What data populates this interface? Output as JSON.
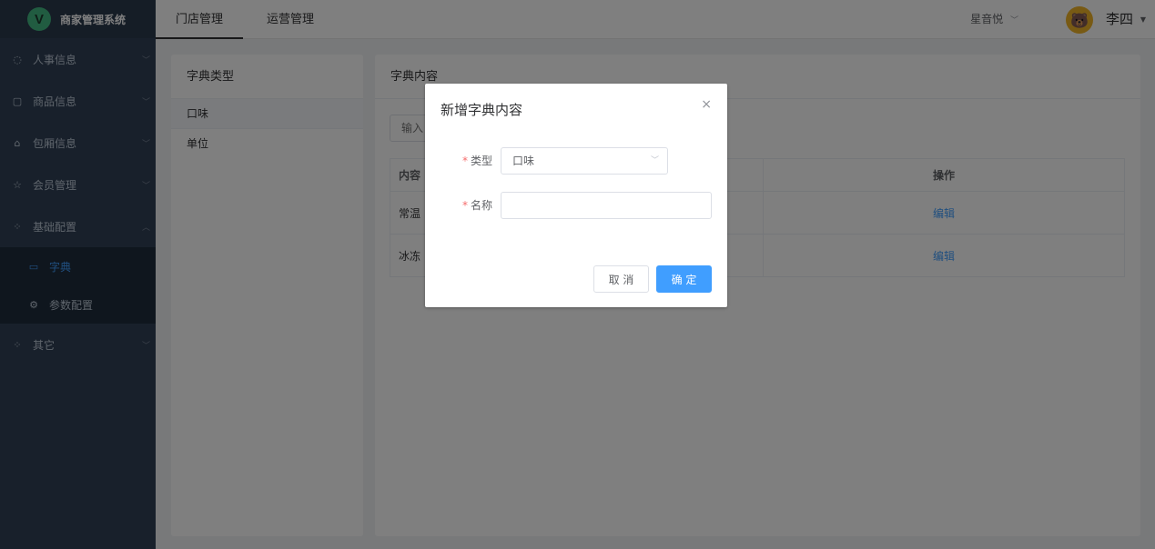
{
  "app": {
    "title": "商家管理系统",
    "logo_letter": "V"
  },
  "sidebar": {
    "items": [
      {
        "label": "人事信息",
        "icon": "◌"
      },
      {
        "label": "商品信息",
        "icon": "▢"
      },
      {
        "label": "包厢信息",
        "icon": "⌂"
      },
      {
        "label": "会员管理",
        "icon": "☆"
      },
      {
        "label": "基础配置",
        "icon": "⁘"
      }
    ],
    "sub_items": [
      {
        "label": "字典",
        "icon": "▭"
      },
      {
        "label": "参数配置",
        "icon": "⚙"
      }
    ],
    "other": {
      "label": "其它",
      "icon": "⁘"
    }
  },
  "header": {
    "tabs": [
      "门店管理",
      "运营管理"
    ],
    "store": "星音悦",
    "store_chevron": "﹀",
    "user": "李四",
    "caret": "▼"
  },
  "left_panel": {
    "title": "字典类型",
    "types": [
      "口味",
      "单位"
    ]
  },
  "right_panel": {
    "title": "字典内容",
    "search_placeholder": "输入",
    "columns": {
      "content": "内容",
      "operation": "操作"
    },
    "rows": [
      {
        "content": "常温",
        "action": "编辑"
      },
      {
        "content": "冰冻",
        "action": "编辑"
      }
    ]
  },
  "dialog": {
    "title": "新增字典内容",
    "close": "×",
    "type_label": "类型",
    "type_value": "口味",
    "name_label": "名称",
    "name_value": "",
    "required_mark": "*",
    "cancel": "取 消",
    "confirm": "确 定"
  },
  "colors": {
    "primary": "#409eff",
    "sidebar": "#304156",
    "required": "#f56c6c"
  }
}
